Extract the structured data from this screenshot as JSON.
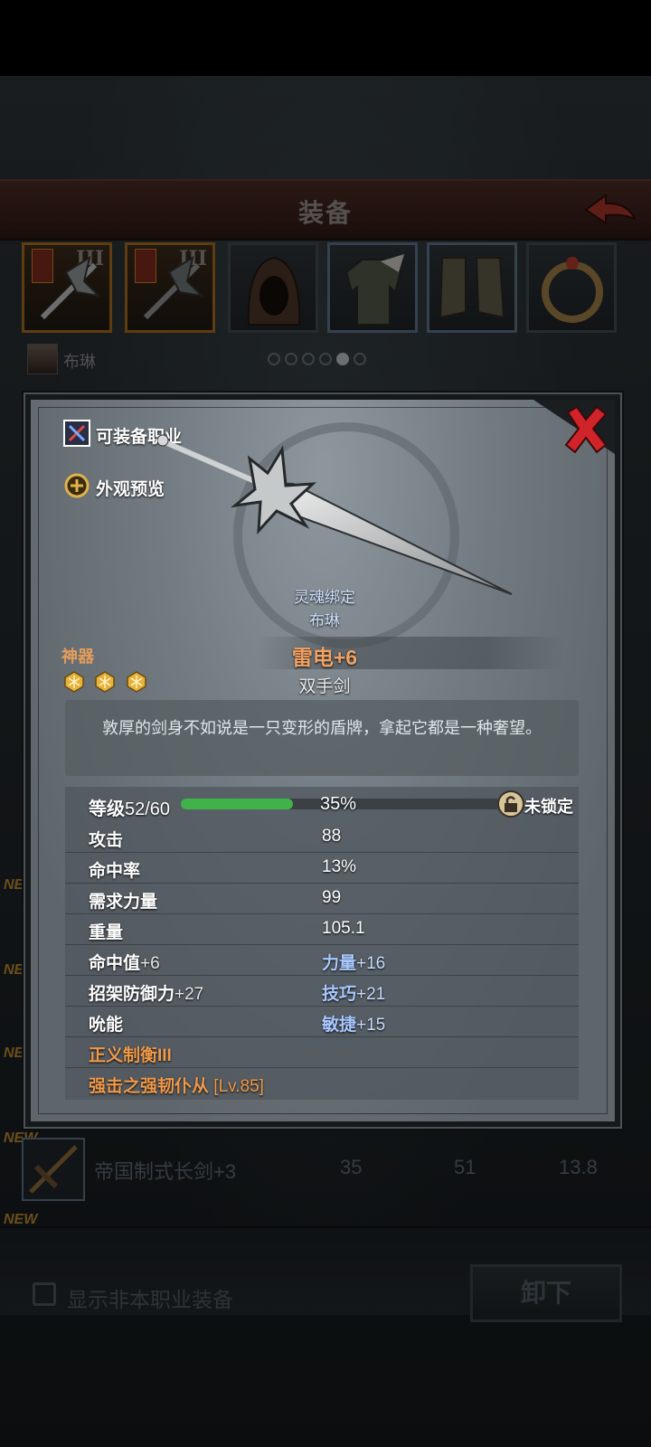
{
  "header": {
    "title": "装备"
  },
  "slots": [
    {
      "tier": "III",
      "kind": "weapon",
      "frame": "gold"
    },
    {
      "tier": "III",
      "kind": "weapon",
      "frame": "gold"
    },
    {
      "tier": "",
      "kind": "hood",
      "frame": "gray"
    },
    {
      "tier": "",
      "kind": "armor",
      "frame": "blue"
    },
    {
      "tier": "",
      "kind": "boots",
      "frame": "blue"
    },
    {
      "tier": "",
      "kind": "ring",
      "frame": "gray"
    }
  ],
  "character": {
    "name": "布琳",
    "page_dots": 6,
    "active_dot": 4
  },
  "list_new_tags": [
    "NEW",
    "NEW",
    "NEW",
    "NEW",
    "NEW"
  ],
  "list_item": {
    "name": "帝国制式长剑",
    "plus": "+3",
    "values": [
      "35",
      "51",
      "13.8"
    ]
  },
  "footer": {
    "checkbox_label": "显示非本职业装备",
    "unequip": "卸下"
  },
  "modal": {
    "links": {
      "class_label": "可装备职业",
      "preview_label": "外观预览"
    },
    "soulbound": {
      "label": "灵魂绑定",
      "owner": "布琳"
    },
    "grade": "神器",
    "item_name": "雷电+6",
    "stars": 3,
    "weapon_type": "双手剑",
    "description": "敦厚的剑身不如说是一只变形的盾牌，拿起它都是一种奢望。",
    "level": {
      "label": "等级",
      "value": "52/60",
      "progress_percent": 35,
      "progress_text": "35%",
      "lock_text": "未锁定"
    },
    "stats": [
      {
        "label": "攻击",
        "value": "88"
      },
      {
        "label": "命中率",
        "value": "13%"
      },
      {
        "label": "需求力量",
        "value": "99"
      },
      {
        "label": "重量",
        "value": "105.1"
      }
    ],
    "bonuses": [
      {
        "left_name": "命中值",
        "left_plus": "+6",
        "right_name": "力量",
        "right_plus": "+16"
      },
      {
        "left_name": "招架防御力",
        "left_plus": "+27",
        "right_name": "技巧",
        "right_plus": "+21"
      },
      {
        "left_name": "吮能",
        "left_plus": "",
        "right_name": "敏捷",
        "right_plus": "+15"
      }
    ],
    "skills": [
      {
        "text": "正义制衡III"
      },
      {
        "name": "强击之强韧仆从",
        "level": "[Lv.85]"
      }
    ]
  },
  "colors": {
    "artifact_orange": "#f0a264",
    "xp_green": "#3fb24a",
    "bonus_blue": "#a8c8ff",
    "close_red": "#d1242a"
  }
}
